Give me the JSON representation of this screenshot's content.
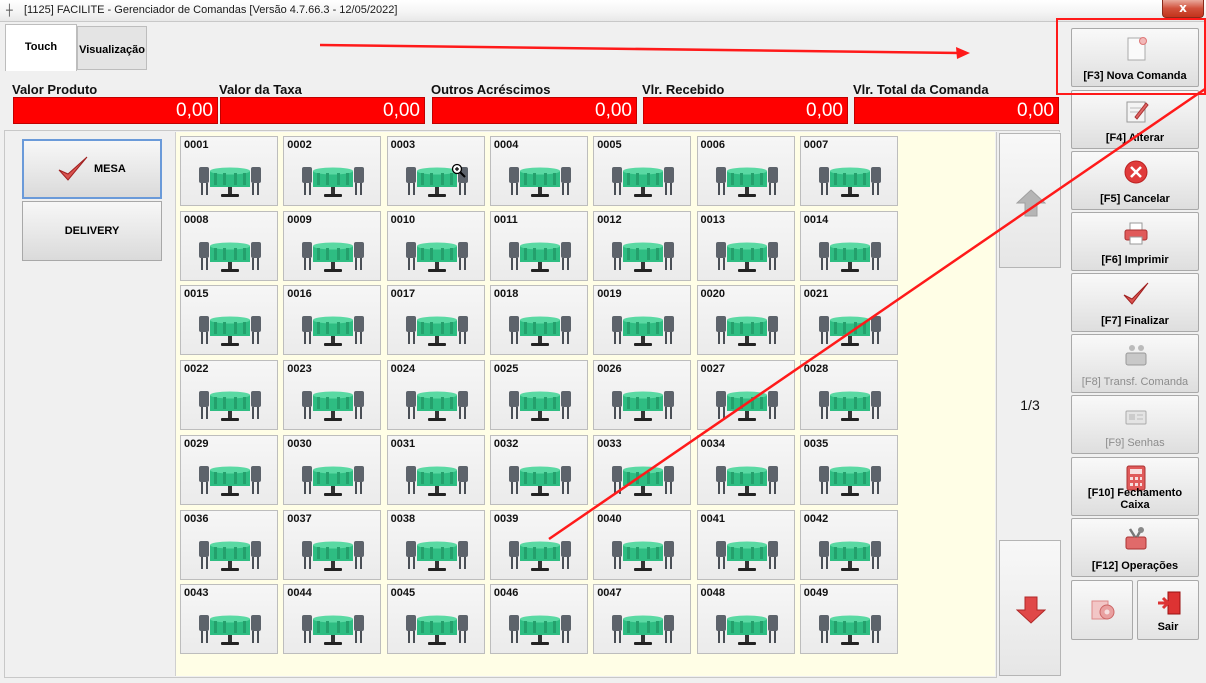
{
  "window": {
    "title": "[1125] FACILITE - Gerenciador de Comandas [Versão 4.7.66.3 - 12/05/2022]",
    "close_label": "x"
  },
  "tabs": [
    {
      "label": "Touch",
      "active": true
    },
    {
      "label": "Visualização",
      "active": false
    }
  ],
  "totals": [
    {
      "label": "Valor Produto",
      "value": "0,00"
    },
    {
      "label": "Valor da Taxa",
      "value": "0,00"
    },
    {
      "label": "Outros Acréscimos",
      "value": "0,00"
    },
    {
      "label": "Vlr. Recebido",
      "value": "0,00"
    },
    {
      "label": "Vlr. Total da Comanda",
      "value": "0,00"
    }
  ],
  "modes": {
    "mesa": "MESA",
    "delivery": "DELIVERY"
  },
  "tables": [
    "0001",
    "0002",
    "0003",
    "0004",
    "0005",
    "0006",
    "0007",
    "0008",
    "0009",
    "0010",
    "0011",
    "0012",
    "0013",
    "0014",
    "0015",
    "0016",
    "0017",
    "0018",
    "0019",
    "0020",
    "0021",
    "0022",
    "0023",
    "0024",
    "0025",
    "0026",
    "0027",
    "0028",
    "0029",
    "0030",
    "0031",
    "0032",
    "0033",
    "0034",
    "0035",
    "0036",
    "0037",
    "0038",
    "0039",
    "0040",
    "0041",
    "0042",
    "0043",
    "0044",
    "0045",
    "0046",
    "0047",
    "0048",
    "0049"
  ],
  "pagination": {
    "indicator": "1/3"
  },
  "toolbar": [
    {
      "label": "[F3] Nova Comanda",
      "icon": "new-document-icon",
      "enabled": true
    },
    {
      "label": "[F4] Alterar",
      "icon": "edit-icon",
      "enabled": true
    },
    {
      "label": "[F5] Cancelar",
      "icon": "cancel-icon",
      "enabled": true
    },
    {
      "label": "[F6] Imprimir",
      "icon": "printer-icon",
      "enabled": true
    },
    {
      "label": "[F7] Finalizar",
      "icon": "check-icon",
      "enabled": true
    },
    {
      "label": "[F8] Transf. Comanda",
      "icon": "transfer-icon",
      "enabled": false
    },
    {
      "label": "[F9] Senhas",
      "icon": "password-card-icon",
      "enabled": false
    },
    {
      "label": "[F10] Fechamento Caixa",
      "icon": "calculator-icon",
      "enabled": true
    },
    {
      "label": "[F12] Operações",
      "icon": "operations-icon",
      "enabled": true
    }
  ],
  "bottom_buttons": {
    "settings_label": "",
    "exit_label": "Sair"
  },
  "colors": {
    "total_field_bg": "#ff0000",
    "annotation_red": "#ff1a1a",
    "table_top": "#2ebd82",
    "grid_background": "#fffee6"
  }
}
